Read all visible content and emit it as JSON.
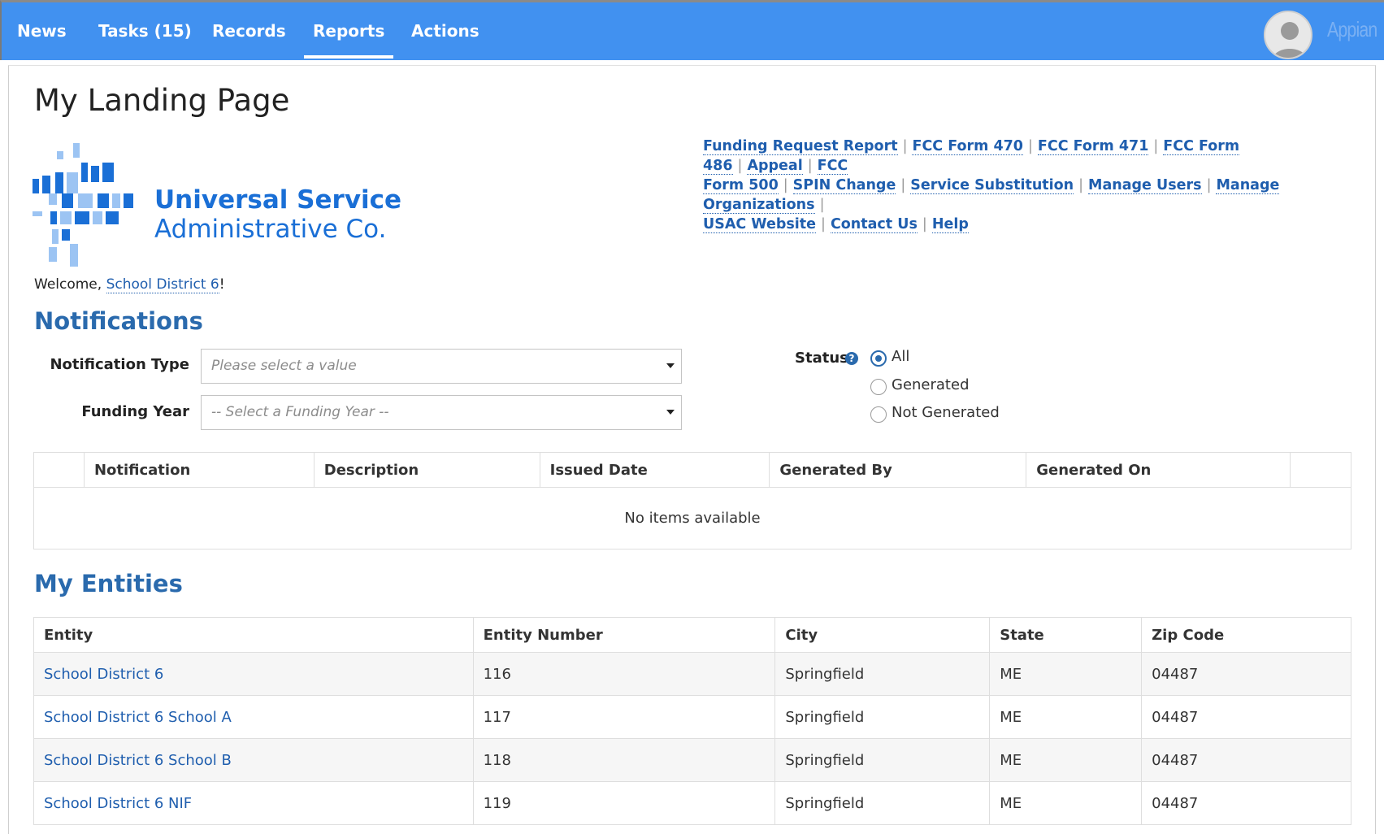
{
  "nav": {
    "items": [
      {
        "label": "News"
      },
      {
        "label": "Tasks (15)"
      },
      {
        "label": "Records"
      },
      {
        "label": "Reports"
      },
      {
        "label": "Actions"
      }
    ],
    "active": "Reports",
    "brand": "Appian"
  },
  "page": {
    "title": "My Landing Page",
    "logo_line1": "Universal Service",
    "logo_line2": "Administrative Co.",
    "welcome_prefix": "Welcome,",
    "welcome_user": "School District 6",
    "welcome_suffix": "!"
  },
  "links": [
    "Funding Request Report",
    "FCC Form 470",
    "FCC Form 471",
    "FCC Form 486",
    "Appeal",
    "FCC",
    "Form 500",
    "SPIN Change",
    "Service Substitution",
    "Manage Users",
    "Manage Organizations",
    "USAC Website",
    "Contact Us",
    "Help"
  ],
  "notifications": {
    "title": "Notifications",
    "type_label": "Notification Type",
    "type_placeholder": "Please select a value",
    "year_label": "Funding Year",
    "year_placeholder": "-- Select a Funding Year --",
    "status_label": "Status",
    "status_options": [
      "All",
      "Generated",
      "Not Generated"
    ],
    "status_selected": "All",
    "columns": [
      "",
      "Notification",
      "Description",
      "Issued Date",
      "Generated By",
      "Generated On",
      ""
    ],
    "empty_text": "No items available"
  },
  "entities": {
    "title": "My Entities",
    "columns": [
      "Entity",
      "Entity Number",
      "City",
      "State",
      "Zip Code"
    ],
    "rows": [
      {
        "entity": "School District 6",
        "number": "116",
        "city": "Springfield",
        "state": "ME",
        "zip": "04487"
      },
      {
        "entity": "School District 6 School A",
        "number": "117",
        "city": "Springfield",
        "state": "ME",
        "zip": "04487"
      },
      {
        "entity": "School District 6 School B",
        "number": "118",
        "city": "Springfield",
        "state": "ME",
        "zip": "04487"
      },
      {
        "entity": "School District 6 NIF",
        "number": "119",
        "city": "Springfield",
        "state": "ME",
        "zip": "04487"
      }
    ]
  },
  "colors": {
    "nav_bg": "#4191f0",
    "link": "#1f5eae",
    "section_title": "#2a6aad",
    "logo_blue": "#1a6fd6"
  }
}
